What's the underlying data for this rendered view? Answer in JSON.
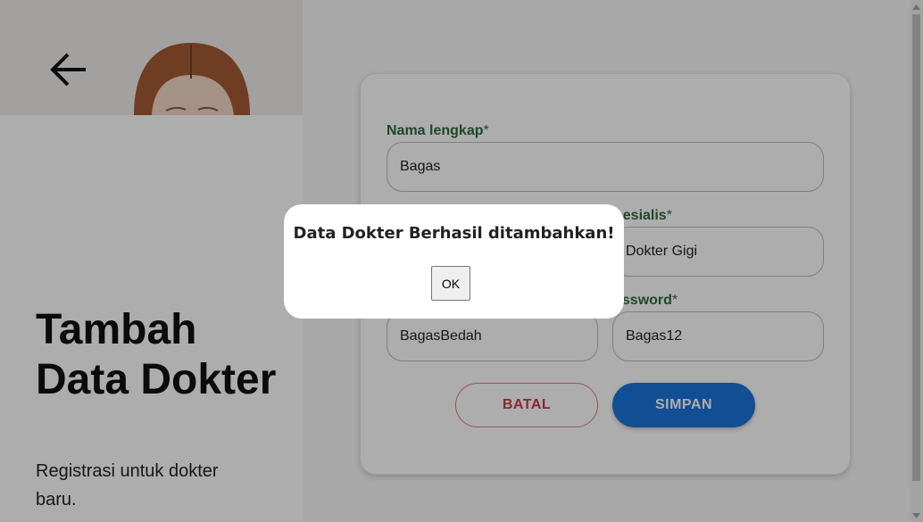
{
  "hero": {
    "title": "Tambah Data Dokter",
    "subtitle": "Registrasi untuk dokter baru."
  },
  "icons": {
    "back": "arrow-left-icon"
  },
  "form": {
    "fields": [
      {
        "label": "Nama lengkap",
        "required_mark": "*",
        "value": "Bagas"
      },
      {
        "label": "pesialis",
        "required_mark": "*",
        "value": "Dokter Gigi"
      },
      {
        "label": "assword",
        "required_mark": "*",
        "value": "Bagas12"
      },
      {
        "label": "",
        "required_mark": "",
        "value": "BagasBedah"
      }
    ],
    "cancel_label": "BATAL",
    "save_label": "SIMPAN"
  },
  "dialog": {
    "message": "Data Dokter Berhasil ditambahkan!",
    "ok_label": "OK"
  },
  "colors": {
    "label_green": "#2e6b3f",
    "primary_blue": "#1a73d9",
    "danger_red": "#c93a46"
  }
}
